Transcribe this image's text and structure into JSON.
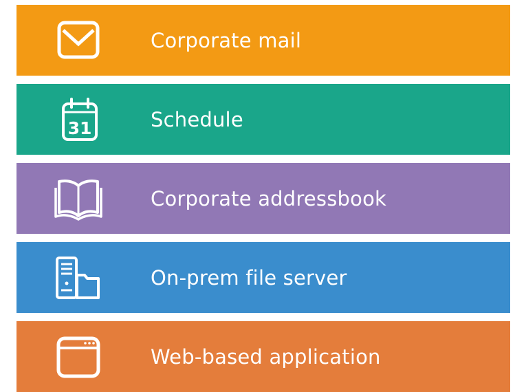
{
  "items": [
    {
      "label": "Corporate mail",
      "icon": "mail-icon",
      "color": "#f39a14"
    },
    {
      "label": "Schedule",
      "icon": "calendar-icon",
      "color": "#1aa68a",
      "calendar_day": "31"
    },
    {
      "label": "Corporate addressbook",
      "icon": "open-book-icon",
      "color": "#9178b5"
    },
    {
      "label": "On-prem file server",
      "icon": "server-folder-icon",
      "color": "#3a8dcd"
    },
    {
      "label": "Web-based application",
      "icon": "browser-window-icon",
      "color": "#e47d3b"
    }
  ]
}
